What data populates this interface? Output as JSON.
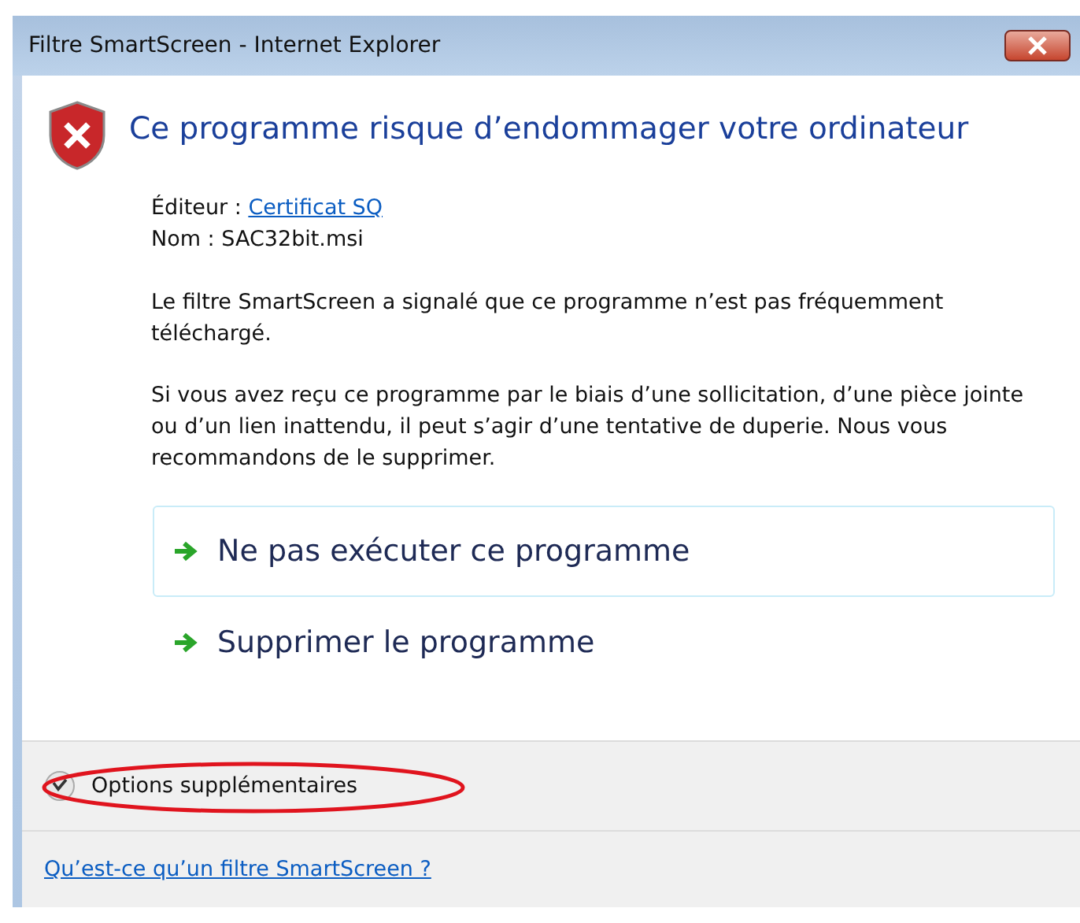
{
  "window": {
    "title": "Filtre SmartScreen - Internet Explorer"
  },
  "heading": "Ce programme risque d’endommager votre ordinateur",
  "details": [
    {
      "label": "Éditeur :",
      "value": "Certificat SQ",
      "kind": "link"
    },
    {
      "label": "Nom :",
      "value": "SAC32bit.msi",
      "kind": "text"
    }
  ],
  "paragraphs": [
    "Le filtre SmartScreen a signalé que ce programme n’est pas fréquemment téléchargé.",
    "Si vous avez reçu ce programme par le biais d’une sollicitation, d’une pièce jointe ou d’un lien inattendu, il peut s’agir d’une tentative de duperie. Nous vous recommandons de le supprimer."
  ],
  "commands": [
    {
      "label": "Ne pas exécuter ce programme",
      "selected": true
    },
    {
      "label": "Supprimer le programme",
      "selected": false
    }
  ],
  "options": {
    "label": "Options supplémentaires",
    "expanded": false,
    "highlighted": true
  },
  "footer_link": "Qu’est-ce qu’un filtre SmartScreen ?"
}
